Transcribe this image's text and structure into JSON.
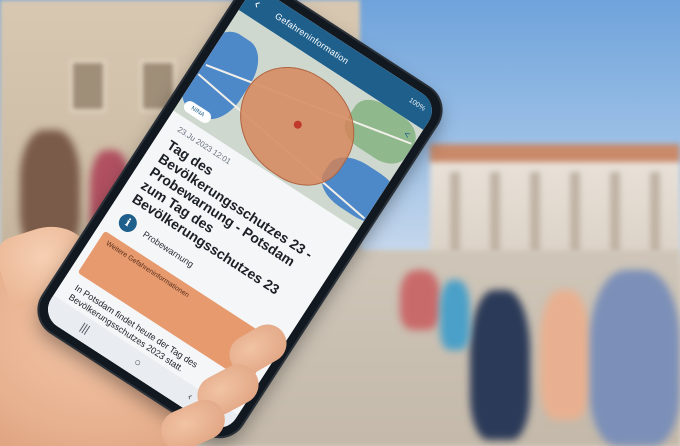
{
  "app": {
    "title": "Gefahreninformation",
    "status_text": "100%",
    "back_icon": "back-arrow-icon",
    "share_icon": "share-icon"
  },
  "map": {
    "logo_text": "NINA"
  },
  "alert": {
    "date": "23.Ju 2023 12:01",
    "headline": "Tag des Bevölkerungsschutzes 23 - Probewarnung - Potsdam zum Tag des Bevölkerungsschutzes 23",
    "info_label": "Probewarnung",
    "warning_box_text": "Weitere Gefahreninformationen",
    "body": "In Potsdam findet heute der Tag des Bevölkerungsschutzes 2023 statt."
  },
  "navigation": {
    "recent": "|||",
    "home": "○",
    "back": "‹"
  },
  "colors": {
    "app_bar": "#1e5f8c",
    "warning_zone": "#d68458",
    "warning_box": "#e79a6e"
  }
}
